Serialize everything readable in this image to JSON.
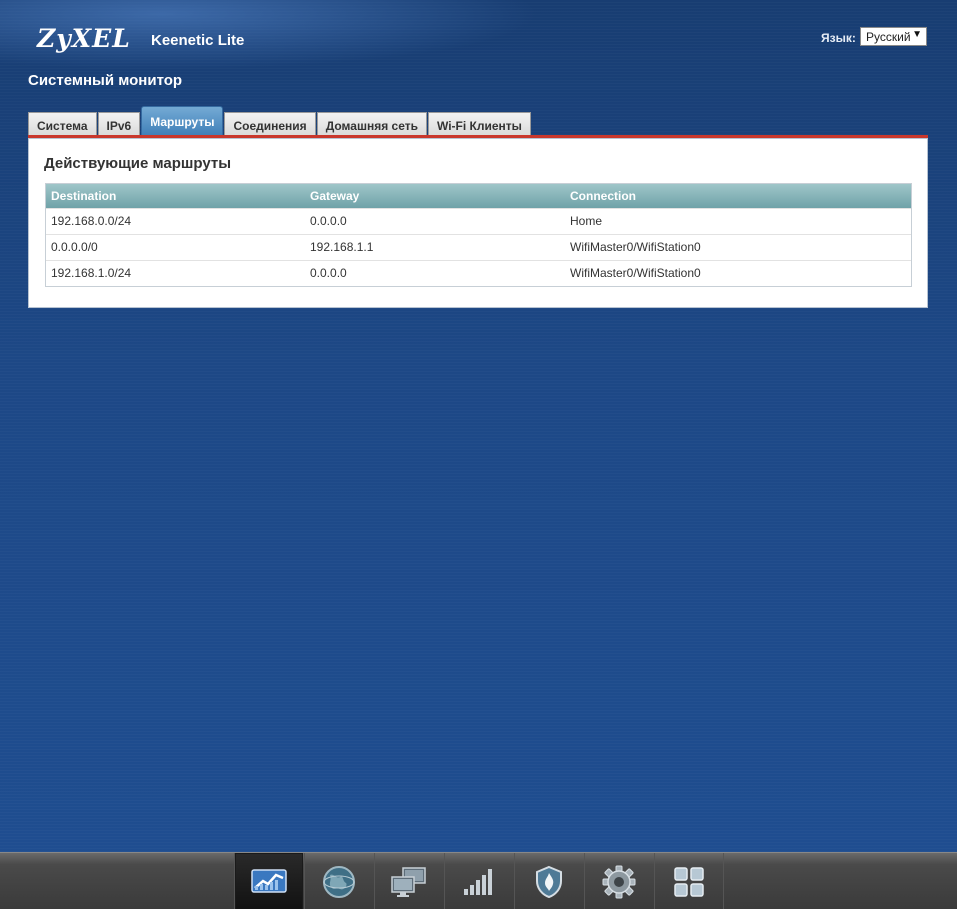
{
  "header": {
    "brand": "ZyXEL",
    "model": "Keenetic Lite",
    "language_label": "Язык:",
    "language_selected": "Русский"
  },
  "page": {
    "title": "Системный монитор"
  },
  "tabs": [
    {
      "label": "Система",
      "active": false
    },
    {
      "label": "IPv6",
      "active": false
    },
    {
      "label": "Маршруты",
      "active": true
    },
    {
      "label": "Соединения",
      "active": false
    },
    {
      "label": "Домашняя сеть",
      "active": false
    },
    {
      "label": "Wi-Fi Клиенты",
      "active": false
    }
  ],
  "panel": {
    "title": "Действующие маршруты",
    "table": {
      "columns": [
        "Destination",
        "Gateway",
        "Connection"
      ],
      "rows": [
        [
          "192.168.0.0/24",
          "0.0.0.0",
          "Home"
        ],
        [
          "0.0.0.0/0",
          "192.168.1.1",
          "WifiMaster0/WifiStation0"
        ],
        [
          "192.168.1.0/24",
          "0.0.0.0",
          "WifiMaster0/WifiStation0"
        ]
      ]
    }
  },
  "toolbar": {
    "items": [
      {
        "icon": "monitor-chart-icon",
        "active": true
      },
      {
        "icon": "globe-icon",
        "active": false
      },
      {
        "icon": "home-network-icon",
        "active": false
      },
      {
        "icon": "wifi-signal-icon",
        "active": false
      },
      {
        "icon": "security-shield-icon",
        "active": false
      },
      {
        "icon": "settings-gear-icon",
        "active": false
      },
      {
        "icon": "apps-grid-icon",
        "active": false
      }
    ]
  },
  "colors": {
    "background": "#1f4a8a",
    "tab_active": "#3f7fb8",
    "accent_red": "#c9372c",
    "table_header": "#6fa2a8"
  }
}
